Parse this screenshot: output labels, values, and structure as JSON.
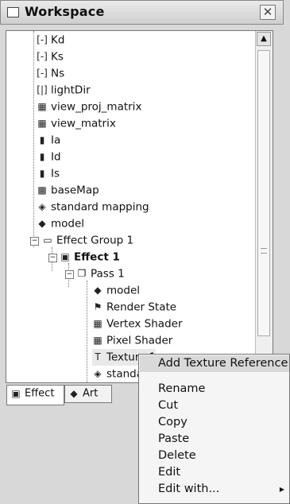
{
  "window": {
    "title": "Workspace",
    "close_label": "✕"
  },
  "tree": [
    {
      "label": "Kd",
      "icon": "scalar-icon",
      "glyph": "[-]"
    },
    {
      "label": "Ks",
      "icon": "scalar-icon",
      "glyph": "[-]"
    },
    {
      "label": "Ns",
      "icon": "scalar-icon",
      "glyph": "[-]"
    },
    {
      "label": "lightDir",
      "icon": "vector-icon",
      "glyph": "[|]"
    },
    {
      "label": "view_proj_matrix",
      "icon": "matrix-icon",
      "glyph": "▦"
    },
    {
      "label": "view_matrix",
      "icon": "matrix-icon",
      "glyph": "▦"
    },
    {
      "label": "Ia",
      "icon": "color-icon",
      "glyph": "▮"
    },
    {
      "label": "Id",
      "icon": "color-icon",
      "glyph": "▮"
    },
    {
      "label": "Is",
      "icon": "color-icon",
      "glyph": "▮"
    },
    {
      "label": "baseMap",
      "icon": "texture-icon",
      "glyph": "▩"
    },
    {
      "label": "standard mapping",
      "icon": "stream-mapping-icon",
      "glyph": "◈"
    },
    {
      "label": "model",
      "icon": "model-icon",
      "glyph": "◆"
    },
    {
      "label": "Effect Group 1",
      "icon": "folder-icon",
      "glyph": "▭"
    },
    {
      "label": "Effect 1",
      "icon": "effect-icon",
      "glyph": "▣"
    },
    {
      "label": "Pass 1",
      "icon": "pass-icon",
      "glyph": "❐"
    },
    {
      "label": "model",
      "icon": "model-icon",
      "glyph": "◆"
    },
    {
      "label": "Render State",
      "icon": "render-state-icon",
      "glyph": "⚑"
    },
    {
      "label": "Vertex Shader",
      "icon": "shader-icon",
      "glyph": "▦"
    },
    {
      "label": "Pixel Shader",
      "icon": "shader-icon",
      "glyph": "▦"
    },
    {
      "label": "Texture 1",
      "icon": "texture-object-icon",
      "glyph": "T"
    },
    {
      "label": "standard mapping",
      "icon": "stream-mapping-icon",
      "glyph": "◈"
    }
  ],
  "tabs": [
    {
      "label": "Effect",
      "icon": "effect-tab-icon"
    },
    {
      "label": "Art",
      "icon": "art-tab-icon"
    }
  ],
  "context_menu": [
    {
      "label": "Add Texture Reference"
    },
    {
      "label": "Rename"
    },
    {
      "label": "Cut"
    },
    {
      "label": "Copy"
    },
    {
      "label": "Paste"
    },
    {
      "label": "Delete"
    },
    {
      "label": "Edit"
    },
    {
      "label": "Edit with..."
    }
  ]
}
